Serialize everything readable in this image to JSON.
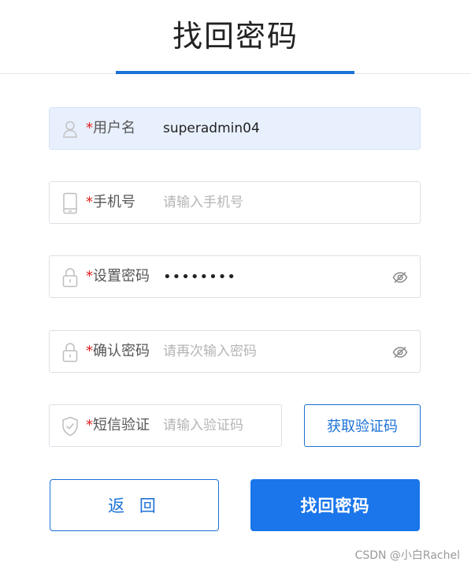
{
  "header": {
    "title": "找回密码"
  },
  "form": {
    "required_mark": "*",
    "username": {
      "icon": "user-icon",
      "label": "用户名",
      "value": "superadmin04",
      "placeholder": ""
    },
    "phone": {
      "icon": "phone-icon",
      "label": "手机号",
      "value": "",
      "placeholder": "请输入手机号"
    },
    "password": {
      "icon": "lock-icon",
      "label": "设置密码",
      "value": "••••••••",
      "placeholder": "",
      "toggle_icon": "eye-off-icon"
    },
    "confirm_password": {
      "icon": "lock-icon",
      "label": "确认密码",
      "value": "",
      "placeholder": "请再次输入密码",
      "toggle_icon": "eye-off-icon"
    },
    "sms_code": {
      "icon": "shield-check-icon",
      "label": "短信验证",
      "value": "",
      "placeholder": "请输入验证码"
    },
    "get_code_label": "获取验证码"
  },
  "actions": {
    "back_label": "返 回",
    "submit_label": "找回密码"
  },
  "watermark": "CSDN @小白Rachel",
  "colors": {
    "accent": "#1b72d6",
    "primary_button": "#1a76ea",
    "required": "#e02020",
    "autofill_bg": "#e8f0fe"
  }
}
